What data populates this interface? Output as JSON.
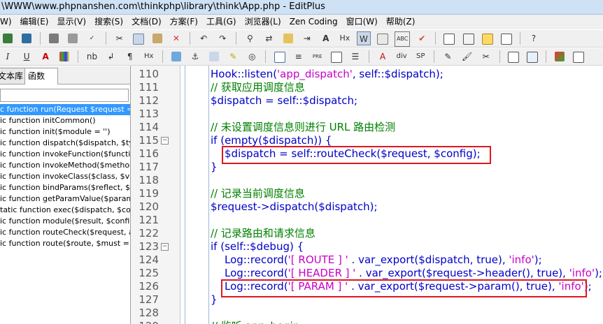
{
  "window": {
    "title": "\\WWW\\www.phpnanshen.com\\thinkphp\\library\\think\\App.php - EditPlus"
  },
  "menu": [
    "W)",
    "编辑(E)",
    "显示(V)",
    "搜索(S)",
    "文档(D)",
    "方案(F)",
    "工具(G)",
    "浏览器(L)",
    "Zen Coding",
    "窗口(W)",
    "帮助(Z)"
  ],
  "toolbar2_labels": {
    "u": "U",
    "i": "I",
    "nb": "nb",
    "p": "¶",
    "pre": "PRE",
    "div": "div",
    "sp": "SP",
    "hx": "Hx"
  },
  "side_tabs": {
    "tab1": "文本库",
    "tab2": "函数"
  },
  "functions": [
    "c function run(Request $request =",
    "ic function initCommon()",
    "ic function init($module = '')",
    "ic function dispatch($dispatch, $typ",
    "ic function invokeFunction($functi",
    "ic function invokeMethod($methoc",
    "ic function invokeClass($class, $var",
    "ic function bindParams($reflect, $v",
    "ic function getParamValue($param",
    "tatic function exec($dispatch, $cor",
    "ic function module($result, $config",
    "ic function routeCheck($request, ar",
    "ic function route($route, $must = fa"
  ],
  "code_lines": [
    {
      "num": "110",
      "fold": "",
      "indent": 1,
      "html": "Hook::listen(<span class='s'>'app_dispatch'</span>, self::$dispatch);"
    },
    {
      "num": "111",
      "fold": "",
      "indent": 1,
      "html": "<span class='c'>// 获取应用调度信息</span>"
    },
    {
      "num": "112",
      "fold": "",
      "indent": 1,
      "html": "$dispatch = self::$dispatch;"
    },
    {
      "num": "113",
      "fold": "",
      "indent": 1,
      "html": ""
    },
    {
      "num": "114",
      "fold": "",
      "indent": 1,
      "html": "<span class='c'>// 未设置调度信息则进行 URL 路由检测</span>"
    },
    {
      "num": "115",
      "fold": "⊟",
      "indent": 1,
      "html": "if (empty($dispatch)) {"
    },
    {
      "num": "116",
      "fold": "",
      "indent": 2,
      "html": "$dispatch = self::routeCheck($request, $config);"
    },
    {
      "num": "117",
      "fold": "",
      "indent": 1,
      "html": "}"
    },
    {
      "num": "118",
      "fold": "",
      "indent": 1,
      "html": ""
    },
    {
      "num": "119",
      "fold": "",
      "indent": 1,
      "html": "<span class='c'>// 记录当前调度信息</span>"
    },
    {
      "num": "120",
      "fold": "",
      "indent": 1,
      "html": "$request-&gt;dispatch($dispatch);"
    },
    {
      "num": "121",
      "fold": "",
      "indent": 1,
      "html": ""
    },
    {
      "num": "122",
      "fold": "",
      "indent": 1,
      "html": "<span class='c'>// 记录路由和请求信息</span>"
    },
    {
      "num": "123",
      "fold": "⊟",
      "indent": 1,
      "html": "if (self::$debug) {"
    },
    {
      "num": "124",
      "fold": "",
      "indent": 2,
      "html": "Log::record(<span class='s'>'[ ROUTE ] '</span> . var_export($dispatch, true), <span class='s'>'info'</span>);"
    },
    {
      "num": "125",
      "fold": "",
      "indent": 2,
      "html": "Log::record(<span class='s'>'[ HEADER ] '</span> . var_export($request-&gt;header(), true), <span class='s'>'info'</span>);"
    },
    {
      "num": "126",
      "fold": "",
      "indent": 2,
      "html": "Log::record(<span class='s'>'[ PARAM ] '</span> . var_export($request-&gt;param(), true), <span class='s'>'info'</span>);"
    },
    {
      "num": "127",
      "fold": "",
      "indent": 1,
      "html": "}"
    },
    {
      "num": "128",
      "fold": "",
      "indent": 1,
      "html": ""
    },
    {
      "num": "129",
      "fold": "",
      "indent": 1,
      "html": "<span class='c'>// 监听 app_begin</span>"
    }
  ],
  "colors": {
    "accent": "#3399ff",
    "highlight_box": "#e0161f",
    "keyword": "#0000c8",
    "string": "#c800c8",
    "comment": "#008000"
  }
}
